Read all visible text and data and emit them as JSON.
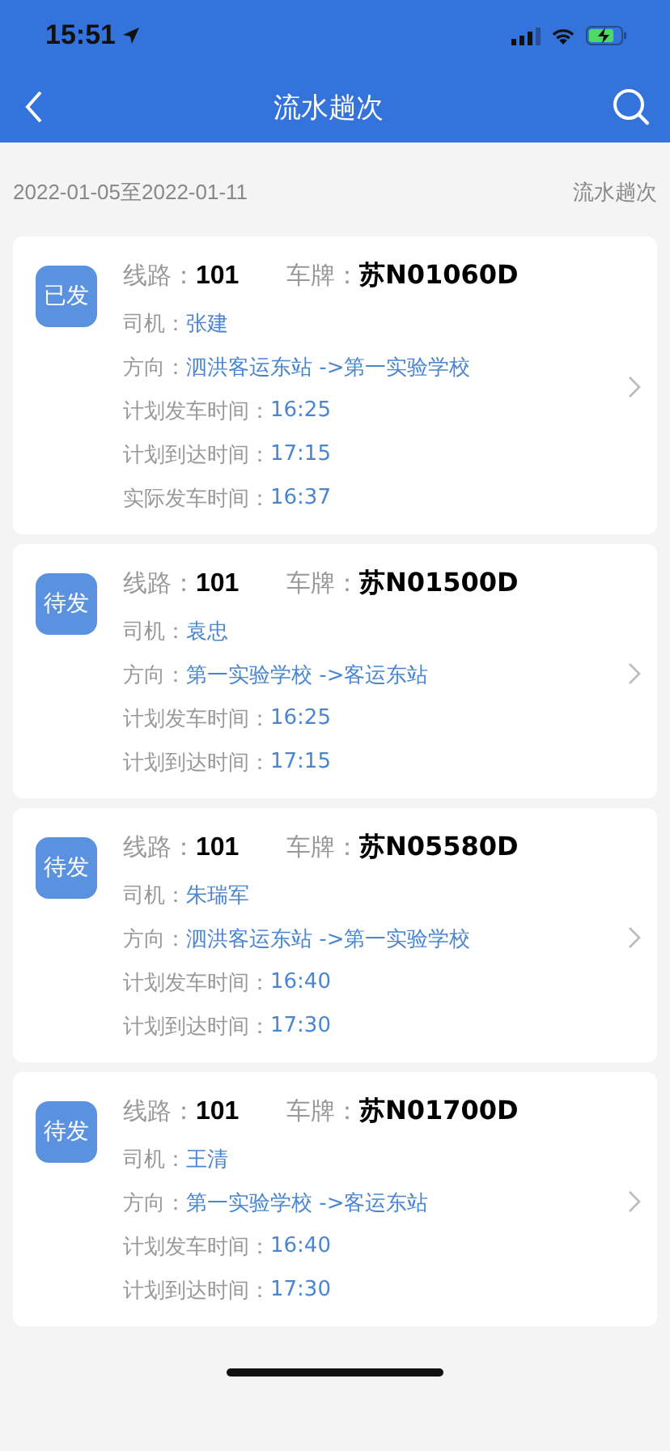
{
  "status_bar": {
    "time": "15:51"
  },
  "header": {
    "title": "流水趟次"
  },
  "date_range": "2022-01-05至2022-01-11",
  "list_label": "流水趟次",
  "trips": [
    {
      "status": "已发",
      "route_label": "线路：",
      "route": "101",
      "plate_label": "车牌：",
      "plate": "苏N01060D",
      "fields": [
        {
          "label": "司机：",
          "value": "张建"
        },
        {
          "label": "方向：",
          "value": "泗洪客运东站 ->第一实验学校"
        },
        {
          "label": "计划发车时间：",
          "value": "16:25"
        },
        {
          "label": "计划到达时间：",
          "value": "17:15"
        },
        {
          "label": "实际发车时间：",
          "value": "16:37"
        }
      ]
    },
    {
      "status": "待发",
      "route_label": "线路：",
      "route": "101",
      "plate_label": "车牌：",
      "plate": "苏N01500D",
      "fields": [
        {
          "label": "司机：",
          "value": "袁忠"
        },
        {
          "label": "方向：",
          "value": "第一实验学校 ->客运东站"
        },
        {
          "label": "计划发车时间：",
          "value": "16:25"
        },
        {
          "label": "计划到达时间：",
          "value": "17:15"
        }
      ]
    },
    {
      "status": "待发",
      "route_label": "线路：",
      "route": "101",
      "plate_label": "车牌：",
      "plate": "苏N05580D",
      "fields": [
        {
          "label": "司机：",
          "value": "朱瑞军"
        },
        {
          "label": "方向：",
          "value": "泗洪客运东站 ->第一实验学校"
        },
        {
          "label": "计划发车时间：",
          "value": "16:40"
        },
        {
          "label": "计划到达时间：",
          "value": "17:30"
        }
      ]
    },
    {
      "status": "待发",
      "route_label": "线路：",
      "route": "101",
      "plate_label": "车牌：",
      "plate": "苏N01700D",
      "fields": [
        {
          "label": "司机：",
          "value": "王清"
        },
        {
          "label": "方向：",
          "value": "第一实验学校 ->客运东站"
        },
        {
          "label": "计划发车时间：",
          "value": "16:40"
        },
        {
          "label": "计划到达时间：",
          "value": "17:30"
        }
      ]
    }
  ]
}
